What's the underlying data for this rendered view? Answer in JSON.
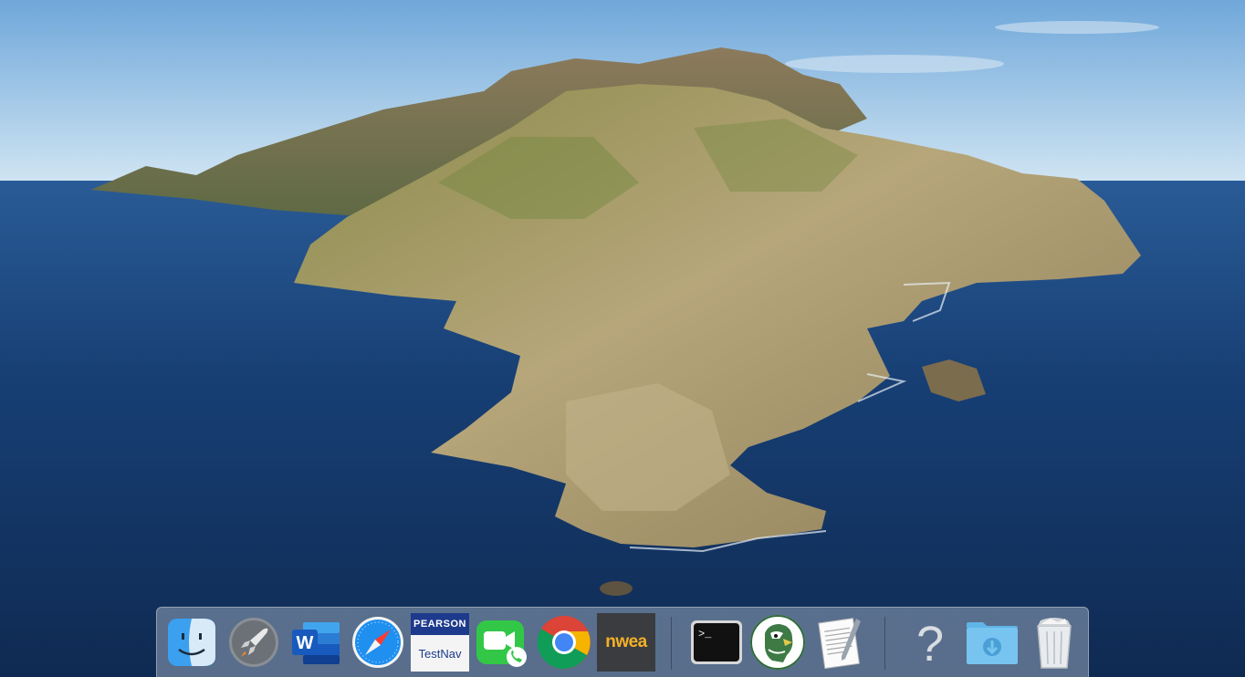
{
  "desktop": {
    "wallpaper": "macOS Catalina island",
    "colors": {
      "sky": "#a9cdea",
      "ocean": "#173f74",
      "island": "#b9a77a"
    }
  },
  "dock": {
    "items": [
      {
        "id": "finder",
        "icon": "finder-icon"
      },
      {
        "id": "launchpad",
        "icon": "launchpad-rocket-icon"
      },
      {
        "id": "word",
        "icon": "microsoft-word-icon",
        "label": "W"
      },
      {
        "id": "safari",
        "icon": "safari-compass-icon"
      },
      {
        "id": "testnav",
        "icon": "pearson-testnav-icon",
        "label_top": "PEARSON",
        "label_bottom": "TestNav"
      },
      {
        "id": "facetime",
        "icon": "facetime-icon"
      },
      {
        "id": "chrome",
        "icon": "chrome-icon"
      },
      {
        "id": "nwea",
        "icon": "nwea-icon",
        "label": "nwea"
      },
      {
        "id": "terminal",
        "icon": "terminal-icon",
        "label": ">_"
      },
      {
        "id": "eagle-app",
        "icon": "eagle-mascot-icon"
      },
      {
        "id": "textedit",
        "icon": "textedit-icon"
      },
      {
        "id": "unknown-app",
        "icon": "question-mark-icon",
        "label": "?"
      },
      {
        "id": "downloads",
        "icon": "downloads-folder-icon"
      },
      {
        "id": "trash",
        "icon": "trash-icon"
      }
    ]
  }
}
